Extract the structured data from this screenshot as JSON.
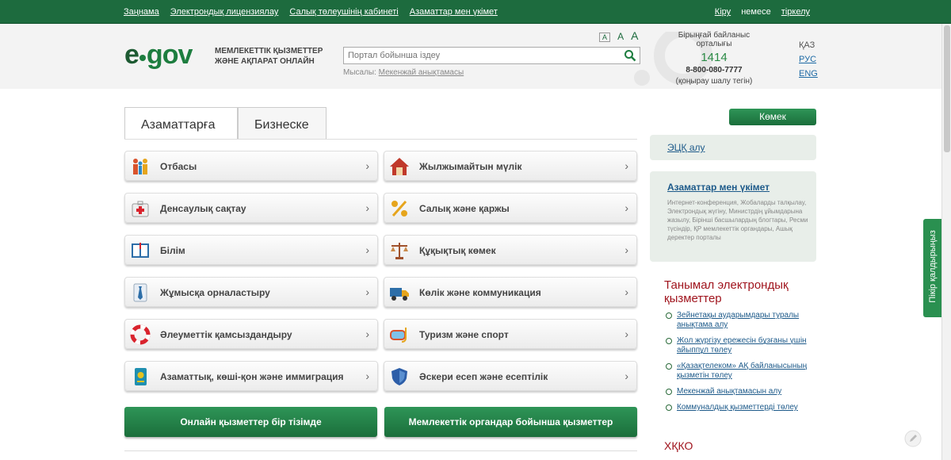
{
  "topnav": {
    "links": [
      "Заңнама",
      "Электрондық лицензиялау",
      "Салық төлеушінің кабинеті",
      "Азаматтар мен үкімет"
    ],
    "login": "Кіру",
    "or": "немесе",
    "register": "тіркелу"
  },
  "header": {
    "logo": {
      "e": "e",
      "gov": "gov"
    },
    "tagline_1": "МЕМЛЕКЕТТІК ҚЫЗМЕТТЕР",
    "tagline_2": "ЖӘНЕ АҚПАРАТ ОНЛАЙН",
    "search_placeholder": "Портал бойынша іздеу",
    "example_label": "Мысалы:",
    "example_link": "Мекенжай анықтамасы",
    "font_sizes": [
      "A",
      "A",
      "A"
    ],
    "call_center": {
      "title": "Бірыңғай байланыс орталығы",
      "short": "1414",
      "phone": "8-800-080-7777",
      "free": "(қоңырау шалу тегін)"
    },
    "langs": [
      "ҚАЗ",
      "РУС",
      "ENG"
    ]
  },
  "tabs": [
    "Азаматтарға",
    "Бизнеске"
  ],
  "categories": [
    {
      "label": "Отбасы",
      "icon": "family-icon"
    },
    {
      "label": "Жылжымайтын мүлік",
      "icon": "house-icon"
    },
    {
      "label": "Денсаулық сақтау",
      "icon": "medkit-icon"
    },
    {
      "label": "Салық және қаржы",
      "icon": "percent-icon"
    },
    {
      "label": "Білім",
      "icon": "book-icon"
    },
    {
      "label": "Құқықтық көмек",
      "icon": "scales-icon"
    },
    {
      "label": "Жұмысқа орналастыру",
      "icon": "tie-icon"
    },
    {
      "label": "Көлік және коммуникация",
      "icon": "truck-icon"
    },
    {
      "label": "Әлеуметтік қамсыздандыру",
      "icon": "lifebuoy-icon"
    },
    {
      "label": "Туризм және спорт",
      "icon": "diving-mask-icon"
    },
    {
      "label": "Азаматтық, көші-қон және иммиграция",
      "icon": "passport-icon"
    },
    {
      "label": "Әскери есеп және есептілік",
      "icon": "shield-icon"
    }
  ],
  "actions": {
    "online_list": "Онлайн қызметтер бір тізімде",
    "by_agencies": "Мемлекеттік органдар бойынша қызметтер"
  },
  "sidebar": {
    "help": "Көмек",
    "ecp": "ЭЦҚ алу",
    "citizens_title": "Азаматтар мен үкімет",
    "citizens_desc": "Интернет-конференция, Жобаларды талқылау, Электрондық жүгіну, Министрдің ұйымдарына жазылу, Бірінші басшылардың блогтары, Ресми түсіндір, ҚР мемлекеттік органдары, Ашық деректер порталы",
    "popular_title": "Танымал электрондық қызметтер",
    "popular": [
      "Зейнетақы аударымдары туралы анықтама алу",
      "Жол жүргізу ережесін бұзғаны үшін айыппұл төлеу",
      "«Қазақтелеком» АҚ байланысының қызметін төлеу",
      "Мекенжай анықтамасын алу",
      "Коммуналдық қызметтерді төлеу"
    ],
    "hkko": "ХҚКО"
  },
  "feedback": "Пікір қалдырыңыз",
  "colors": {
    "brand_green": "#1d6b3e",
    "accent_red": "#a0141d",
    "link_blue": "#1d5a8a"
  }
}
